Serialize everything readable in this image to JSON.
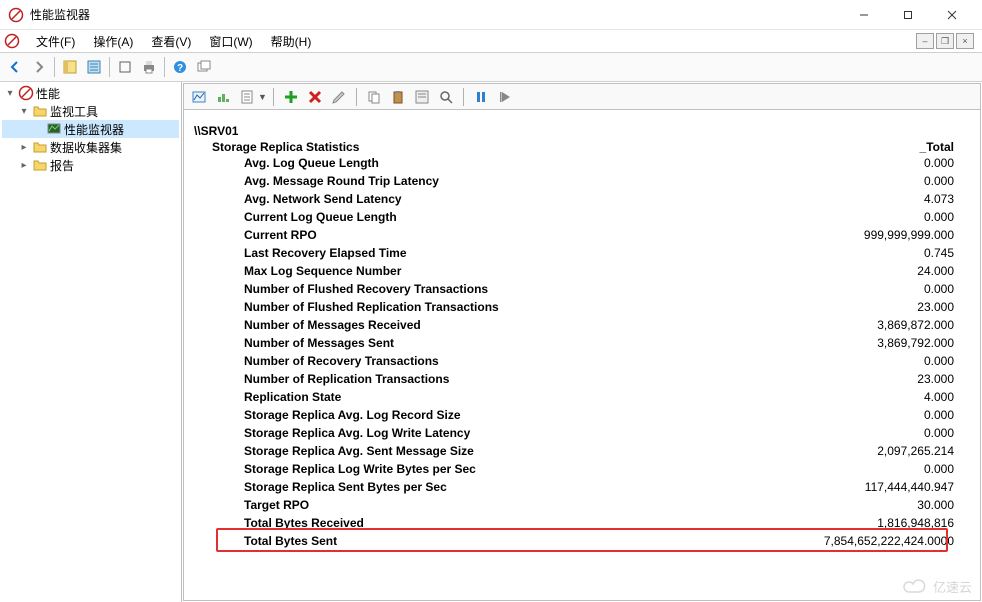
{
  "window": {
    "title": "性能监视器"
  },
  "menu": {
    "file": "文件(F)",
    "action": "操作(A)",
    "view": "查看(V)",
    "window": "窗口(W)",
    "help": "帮助(H)"
  },
  "tree": {
    "root": "性能",
    "monitor_tools": "监视工具",
    "perf_monitor": "性能监视器",
    "data_collector": "数据收集器集",
    "reports": "报告"
  },
  "report": {
    "host": "\\\\SRV01",
    "category": "Storage Replica Statistics",
    "col_header": "_Total",
    "metrics": [
      {
        "name": "Avg. Log Queue Length",
        "value": "0.000"
      },
      {
        "name": "Avg. Message Round Trip Latency",
        "value": "0.000"
      },
      {
        "name": "Avg. Network Send Latency",
        "value": "4.073"
      },
      {
        "name": "Current Log Queue Length",
        "value": "0.000"
      },
      {
        "name": "Current RPO",
        "value": "999,999,999.000"
      },
      {
        "name": "Last Recovery Elapsed Time",
        "value": "0.745"
      },
      {
        "name": "Max Log Sequence Number",
        "value": "24.000"
      },
      {
        "name": "Number of Flushed Recovery Transactions",
        "value": "0.000"
      },
      {
        "name": "Number of Flushed Replication Transactions",
        "value": "23.000"
      },
      {
        "name": "Number of Messages Received",
        "value": "3,869,872.000"
      },
      {
        "name": "Number of Messages Sent",
        "value": "3,869,792.000"
      },
      {
        "name": "Number of Recovery Transactions",
        "value": "0.000"
      },
      {
        "name": "Number of Replication Transactions",
        "value": "23.000"
      },
      {
        "name": "Replication State",
        "value": "4.000"
      },
      {
        "name": "Storage Replica Avg. Log Record Size",
        "value": "0.000"
      },
      {
        "name": "Storage Replica Avg. Log Write Latency",
        "value": "0.000"
      },
      {
        "name": "Storage Replica Avg. Sent Message Size",
        "value": "2,097,265.214"
      },
      {
        "name": "Storage Replica Log Write Bytes per Sec",
        "value": "0.000"
      },
      {
        "name": "Storage Replica Sent Bytes per Sec",
        "value": "117,444,440.947"
      },
      {
        "name": "Target RPO",
        "value": "30.000"
      },
      {
        "name": "Total Bytes Received",
        "value": "1,816,948,816"
      },
      {
        "name": "Total Bytes Sent",
        "value": "7,854,652,222,424.0000"
      }
    ]
  },
  "watermark": "亿速云"
}
